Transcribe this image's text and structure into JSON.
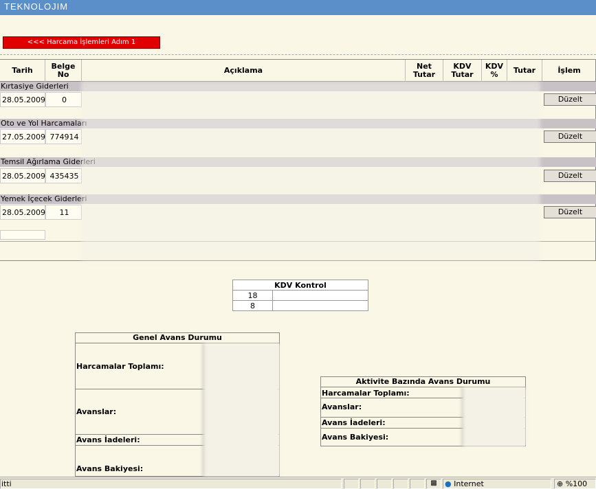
{
  "app": {
    "logo": "TEKNOLOJIM"
  },
  "back_button": "<<< Harcama İşlemleri Adım 1",
  "table": {
    "headers": {
      "tarih": "Tarih",
      "belge": "Belge\nNo",
      "aciklama": "Açıklama",
      "net": "Net\nTutar",
      "kdv_tutar": "KDV\nTutar",
      "kdv_pct": "KDV\n%",
      "tutar": "Tutar",
      "islem": "İşlem"
    },
    "groups": [
      {
        "name": "Kırtasiye Giderleri",
        "date": "28.05.2009",
        "belge": "0",
        "action": "Düzelt"
      },
      {
        "name": "Oto ve Yol Harcamaları",
        "date": "27.05.2009",
        "belge": "774914",
        "action": "Düzelt"
      },
      {
        "name": "Temsil Ağırlama Giderleri",
        "date": "28.05.2009",
        "belge": "435435",
        "action": "Düzelt"
      },
      {
        "name": "Yemek İçecek Giderleri",
        "date": "28.05.2009",
        "belge": "11",
        "action": "Düzelt"
      }
    ]
  },
  "kdv": {
    "title": "KDV Kontrol",
    "rows": [
      "18",
      "8"
    ]
  },
  "genel": {
    "title": "Genel Avans Durumu",
    "harcamalar": "Harcamalar Toplamı:",
    "avanslar": "Avanslar:",
    "iadeler": "Avans İadeleri:",
    "bakiye": "Avans Bakiyesi:"
  },
  "aktivite": {
    "title": "Aktivite Bazında Avans Durumu",
    "harcamalar": "Harcamalar Toplamı:",
    "avanslar": "Avanslar:",
    "iadeler": "Avans İadeleri:",
    "bakiye": "Avans Bakiyesi:"
  },
  "status": {
    "left": "itti",
    "zone": "Internet",
    "zoom": "%100"
  }
}
